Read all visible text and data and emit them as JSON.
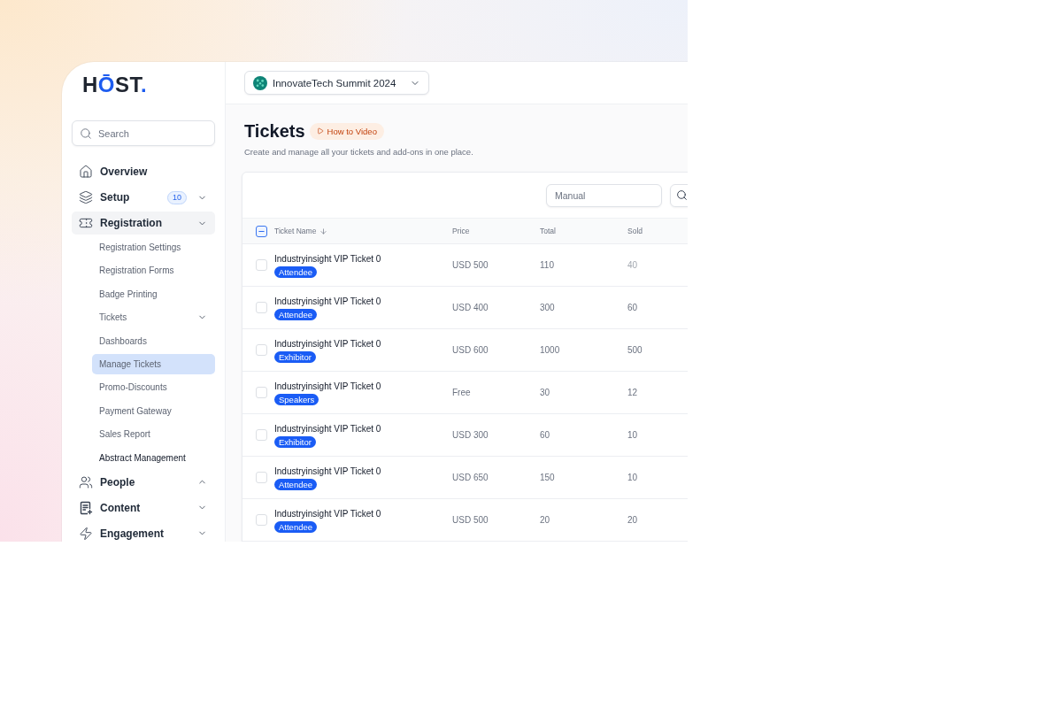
{
  "sidebar": {
    "logo": [
      {
        "text": "H",
        "accent": false
      },
      {
        "text": "Ō",
        "accent": true
      },
      {
        "text": "ST",
        "accent": false
      },
      {
        "text": ".",
        "accent": true
      }
    ],
    "search": {
      "placeholder": "Search"
    },
    "nav": [
      {
        "label": "Overview",
        "selected": false
      },
      {
        "label": "Setup",
        "badge": "10",
        "chevron_up": false,
        "selected": false
      },
      {
        "label": "Registration",
        "chevron_up": false,
        "selected": true,
        "children": [
          {
            "label": "Registration Settings",
            "selected": false,
            "emphasized": false
          },
          {
            "label": "Registration Forms",
            "selected": false,
            "emphasized": false
          },
          {
            "label": "Badge Printing",
            "selected": false,
            "emphasized": false
          },
          {
            "label": "Tickets",
            "chevron_up": false,
            "selected": false,
            "emphasized": false
          },
          {
            "label": "Dashboards",
            "selected": false,
            "emphasized": false
          },
          {
            "label": "Manage Tickets",
            "selected": true,
            "emphasized": false
          },
          {
            "label": "Promo-Discounts",
            "selected": false,
            "emphasized": false
          },
          {
            "label": "Payment Gateway",
            "selected": false,
            "emphasized": false
          },
          {
            "label": "Sales Report",
            "selected": false,
            "emphasized": false
          },
          {
            "label": "Abstract Management",
            "selected": false,
            "emphasized": true
          }
        ]
      },
      {
        "label": "People",
        "chevron_up": true,
        "selected": false
      },
      {
        "label": "Content",
        "chevron_up": false,
        "selected": false
      },
      {
        "label": "Engagement",
        "chevron_up": false,
        "selected": false
      }
    ]
  },
  "event_selector": {
    "label": "InnovateTech Summit 2024"
  },
  "page": {
    "title": "Tickets",
    "video_link": "How to Video",
    "subtitle": "Create and manage all your tickets and add-ons in one place."
  },
  "table": {
    "filter": {
      "value": "Manual"
    },
    "select_all": {
      "indeterminate": true
    },
    "columns": [
      {
        "label": "Ticket Name",
        "sorted": true
      },
      {
        "label": "Price",
        "sorted": false
      },
      {
        "label": "Total",
        "sorted": false
      },
      {
        "label": "Sold",
        "sorted": false
      }
    ],
    "rows": [
      {
        "checked": false,
        "name": "Industryinsight VIP Ticket 0",
        "tag": "Attendee",
        "price": "USD 500",
        "total": "110",
        "sold": "40",
        "sold_dimmed": true
      },
      {
        "checked": false,
        "name": "Industryinsight VIP Ticket 0",
        "tag": "Attendee",
        "price": "USD 400",
        "total": "300",
        "sold": "60",
        "sold_dimmed": false
      },
      {
        "checked": false,
        "name": "Industryinsight VIP Ticket 0",
        "tag": "Exhibitor",
        "price": "USD 600",
        "total": "1000",
        "sold": "500",
        "sold_dimmed": false
      },
      {
        "checked": false,
        "name": "Industryinsight VIP Ticket 0",
        "tag": "Speakers",
        "price": "Free",
        "total": "30",
        "sold": "12",
        "sold_dimmed": false
      },
      {
        "checked": false,
        "name": "Industryinsight VIP Ticket 0",
        "tag": "Exhibitor",
        "price": "USD 300",
        "total": "60",
        "sold": "10",
        "sold_dimmed": false
      },
      {
        "checked": false,
        "name": "Industryinsight VIP Ticket 0",
        "tag": "Attendee",
        "price": "USD 650",
        "total": "150",
        "sold": "10",
        "sold_dimmed": false
      },
      {
        "checked": false,
        "name": "Industryinsight VIP Ticket 0",
        "tag": "Attendee",
        "price": "USD 500",
        "total": "20",
        "sold": "20",
        "sold_dimmed": false
      }
    ]
  }
}
